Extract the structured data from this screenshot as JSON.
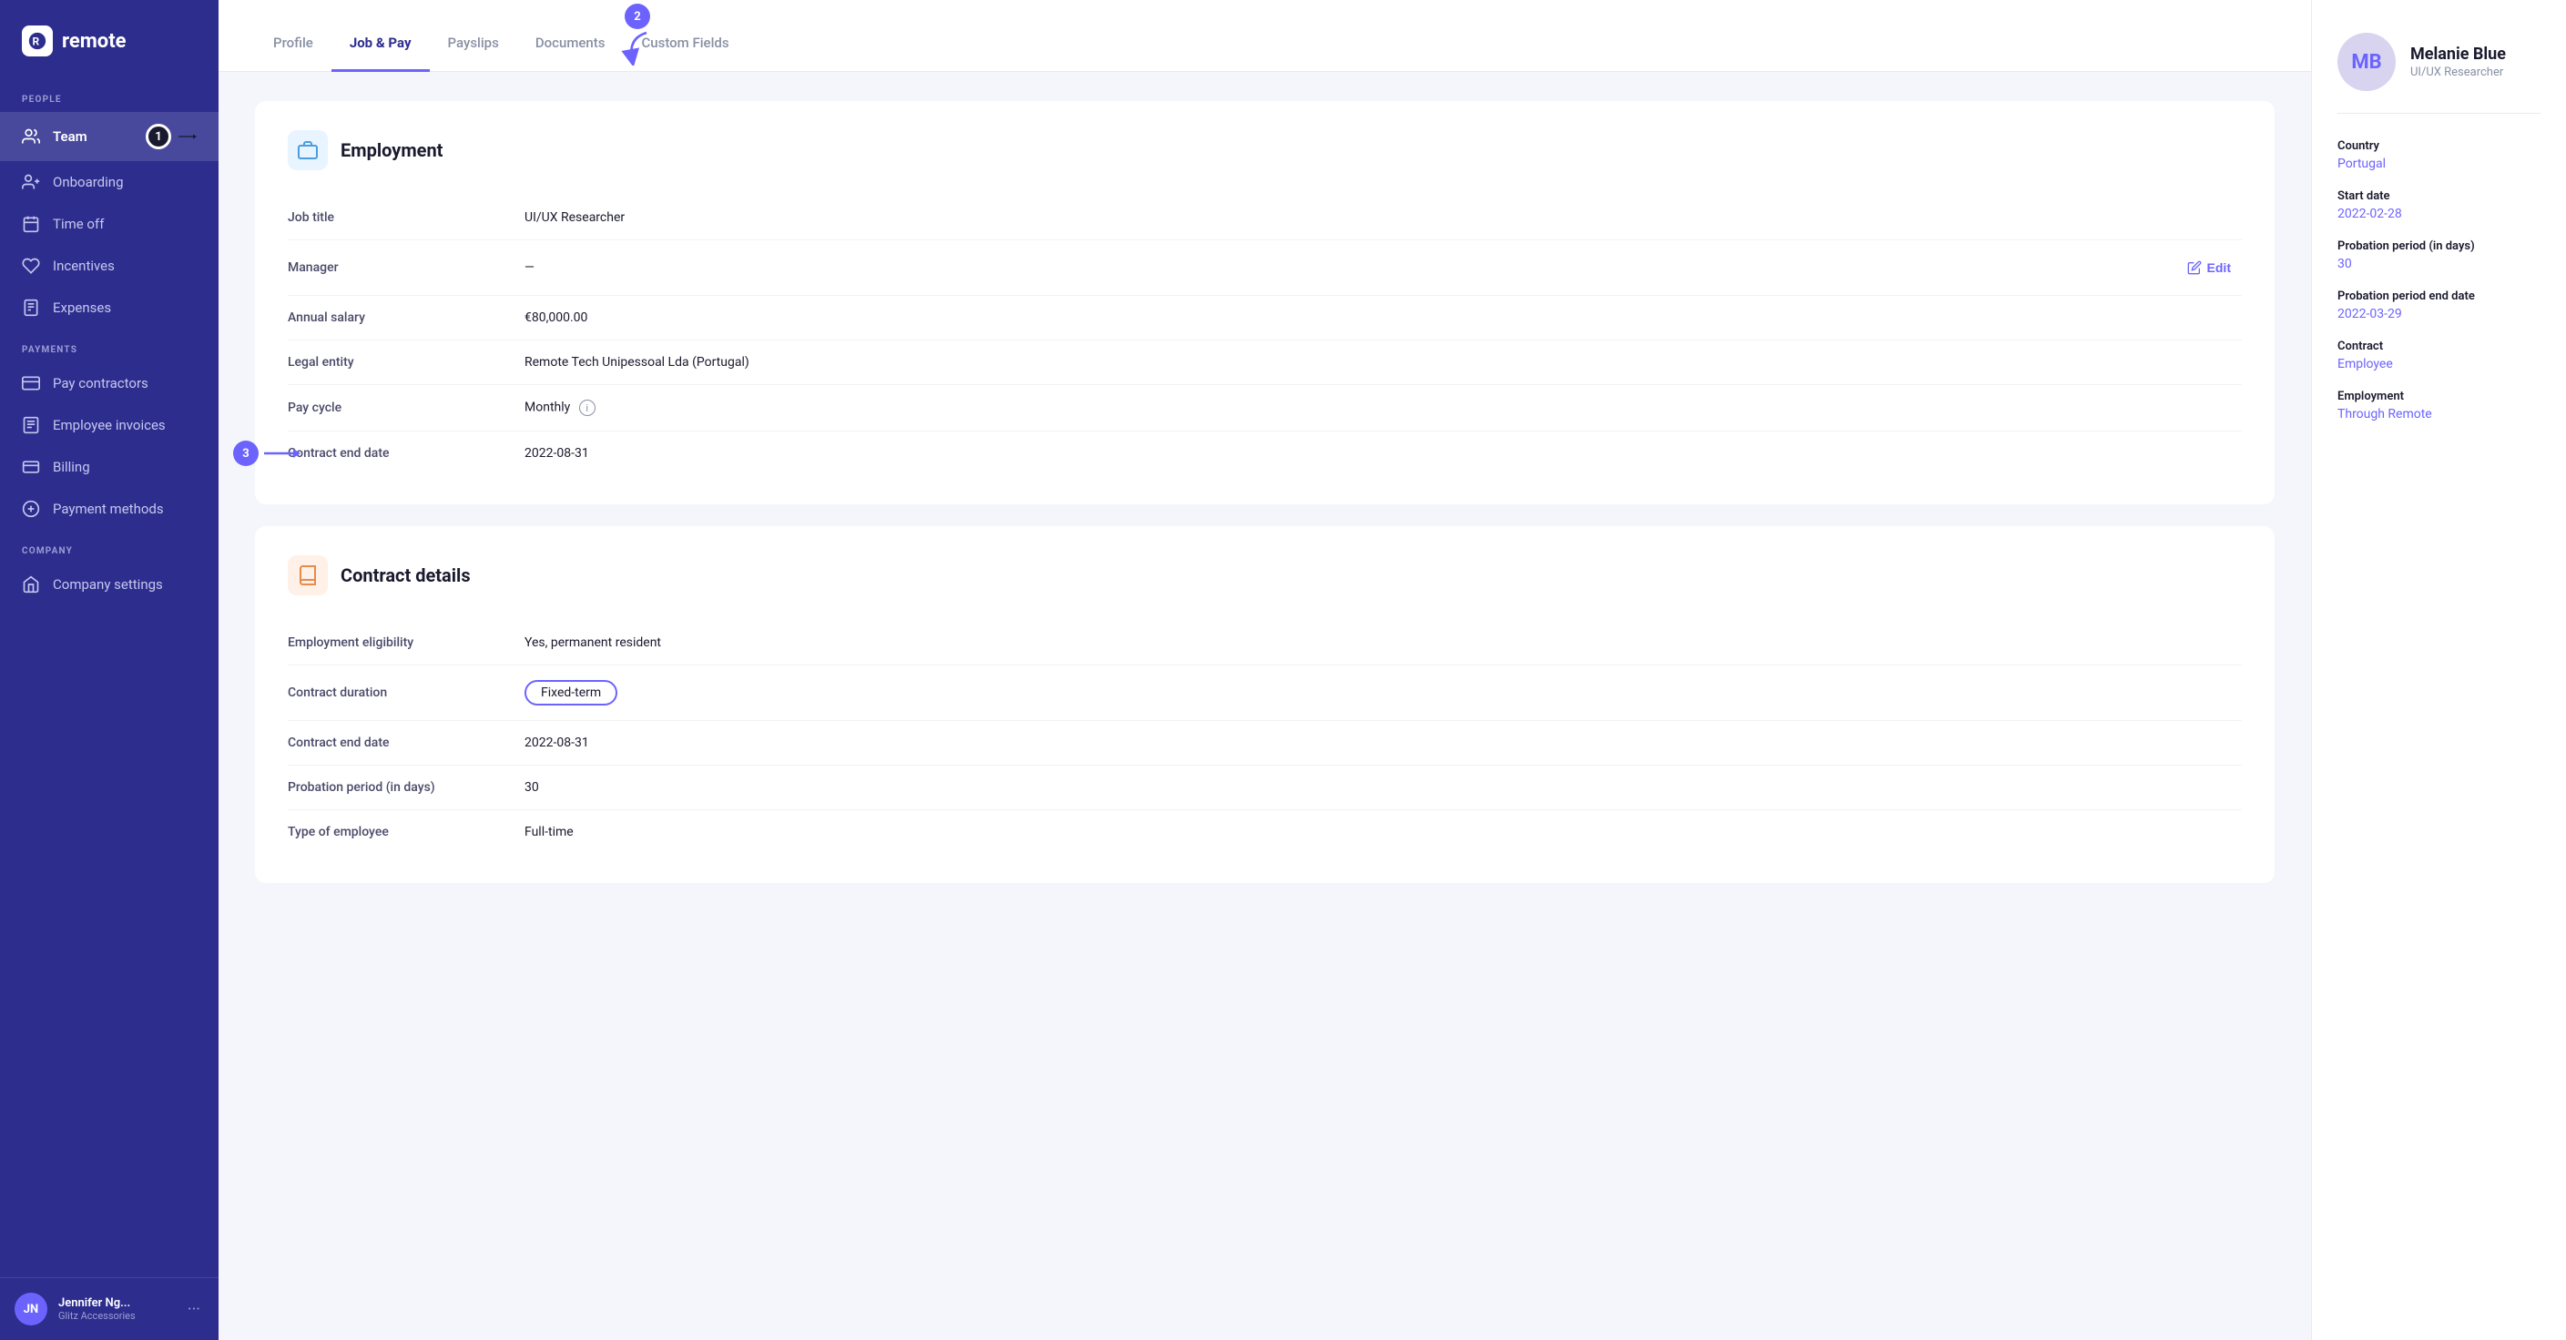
{
  "app": {
    "name": "remote",
    "logo_initials": "R"
  },
  "sidebar": {
    "sections": [
      {
        "label": "PEOPLE",
        "items": [
          {
            "id": "team",
            "label": "Team",
            "active": true,
            "icon": "users-icon"
          },
          {
            "id": "onboarding",
            "label": "Onboarding",
            "active": false,
            "icon": "user-plus-icon"
          },
          {
            "id": "time-off",
            "label": "Time off",
            "active": false,
            "icon": "calendar-icon"
          },
          {
            "id": "incentives",
            "label": "Incentives",
            "active": false,
            "icon": "heart-icon"
          },
          {
            "id": "expenses",
            "label": "Expenses",
            "active": false,
            "icon": "receipt-icon"
          }
        ]
      },
      {
        "label": "PAYMENTS",
        "items": [
          {
            "id": "pay-contractors",
            "label": "Pay contractors",
            "active": false,
            "icon": "credit-card-icon"
          },
          {
            "id": "employee-invoices",
            "label": "Employee invoices",
            "active": false,
            "icon": "invoice-icon"
          },
          {
            "id": "billing",
            "label": "Billing",
            "active": false,
            "icon": "billing-icon"
          },
          {
            "id": "payment-methods",
            "label": "Payment methods",
            "active": false,
            "icon": "payment-icon"
          }
        ]
      },
      {
        "label": "COMPANY",
        "items": [
          {
            "id": "company-settings",
            "label": "Company settings",
            "active": false,
            "icon": "home-icon"
          }
        ]
      }
    ],
    "user": {
      "initials": "JN",
      "name": "Jennifer Ng...",
      "company": "Glitz Accessories"
    }
  },
  "tabs": [
    {
      "id": "profile",
      "label": "Profile",
      "active": false
    },
    {
      "id": "job-pay",
      "label": "Job & Pay",
      "active": true
    },
    {
      "id": "payslips",
      "label": "Payslips",
      "active": false
    },
    {
      "id": "documents",
      "label": "Documents",
      "active": false
    },
    {
      "id": "custom-fields",
      "label": "Custom Fields",
      "active": false
    }
  ],
  "employment_section": {
    "title": "Employment",
    "fields": [
      {
        "id": "job-title",
        "label": "Job title",
        "value": "UI/UX Researcher"
      },
      {
        "id": "manager",
        "label": "Manager",
        "value": "—",
        "editable": true
      },
      {
        "id": "annual-salary",
        "label": "Annual salary",
        "value": "€80,000.00"
      },
      {
        "id": "legal-entity",
        "label": "Legal entity",
        "value": "Remote Tech Unipessoal Lda (Portugal)"
      },
      {
        "id": "pay-cycle",
        "label": "Pay cycle",
        "value": "Monthly",
        "has_info": true
      },
      {
        "id": "contract-end-date",
        "label": "Contract end date",
        "value": "2022-08-31",
        "annotated": true
      }
    ],
    "edit_label": "Edit"
  },
  "contract_section": {
    "title": "Contract details",
    "fields": [
      {
        "id": "employment-eligibility",
        "label": "Employment eligibility",
        "value": "Yes, permanent resident"
      },
      {
        "id": "contract-duration",
        "label": "Contract duration",
        "value": "Fixed-term",
        "badge": true
      },
      {
        "id": "contract-end-date2",
        "label": "Contract end date",
        "value": "2022-08-31"
      },
      {
        "id": "probation-period",
        "label": "Probation period (in days)",
        "value": "30"
      },
      {
        "id": "type-of-employee",
        "label": "Type of employee",
        "value": "Full-time"
      }
    ]
  },
  "right_panel": {
    "avatar_initials": "MB",
    "name": "Melanie Blue",
    "role": "UI/UX Researcher",
    "info": [
      {
        "id": "country",
        "label": "Country",
        "value": "Portugal"
      },
      {
        "id": "start-date",
        "label": "Start date",
        "value": "2022-02-28"
      },
      {
        "id": "probation-days",
        "label": "Probation period (in days)",
        "value": "30"
      },
      {
        "id": "probation-end",
        "label": "Probation period end date",
        "value": "2022-03-29"
      },
      {
        "id": "contract",
        "label": "Contract",
        "value": "Employee"
      },
      {
        "id": "employment",
        "label": "Employment",
        "value": "Through Remote"
      }
    ]
  },
  "annotations": {
    "step1_label": "1",
    "step2_label": "2",
    "step3_label": "3"
  }
}
